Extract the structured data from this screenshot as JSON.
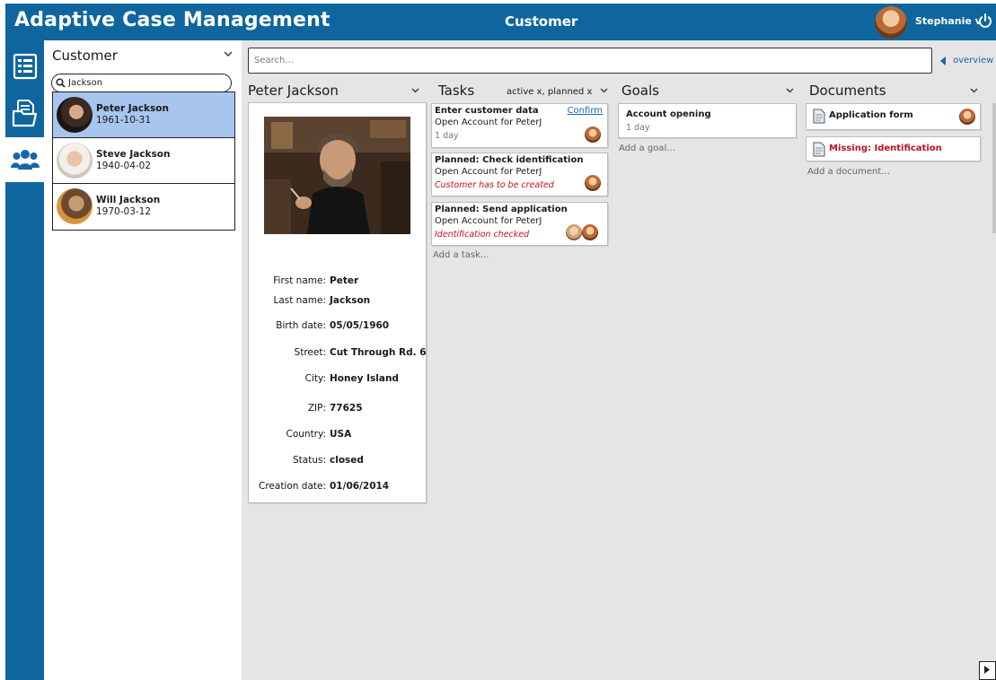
{
  "header": {
    "app_title": "Adaptive Case Management",
    "center_title": "Customer",
    "user_name": "Stephanie v",
    "brand_color": "#0f669f"
  },
  "rail": {
    "items": [
      {
        "icon": "list-icon",
        "active": false
      },
      {
        "icon": "document-folder-icon",
        "active": false
      },
      {
        "icon": "people-icon",
        "active": true
      }
    ]
  },
  "customer_panel": {
    "title": "Customer",
    "search_value": "Jackson",
    "customers": [
      {
        "name": "Peter Jackson",
        "date": "1961-10-31",
        "selected": true
      },
      {
        "name": "Steve Jackson",
        "date": "1940-04-02",
        "selected": false
      },
      {
        "name": "Will Jackson",
        "date": "1970-03-12",
        "selected": false
      }
    ]
  },
  "main": {
    "search_placeholder": "Search...",
    "overview_label": "overview"
  },
  "detail": {
    "header": "Peter Jackson",
    "fields": [
      {
        "label": "First name:",
        "value": "Peter"
      },
      {
        "label": "Last name:",
        "value": "Jackson"
      },
      {
        "label": "Birth date:",
        "value": "05/05/1960"
      },
      {
        "label": "Street:",
        "value": "Cut Through Rd. 6"
      },
      {
        "label": "City:",
        "value": "Honey Island"
      },
      {
        "label": "ZIP:",
        "value": "77625"
      },
      {
        "label": "Country:",
        "value": "USA"
      },
      {
        "label": "Status:",
        "value": "closed"
      },
      {
        "label": "Creation date:",
        "value": "01/06/2014"
      }
    ]
  },
  "tasks": {
    "header": "Tasks",
    "filter": "active x, planned x",
    "add_label": "Add a task...",
    "items": [
      {
        "title": "Enter customer data",
        "subtitle": "Open Account for PeterJ",
        "meta": "1 day",
        "action": "Confirm"
      },
      {
        "title": "Planned: Check identification",
        "subtitle": "Open Account for PeterJ",
        "warning": "Customer has to be created"
      },
      {
        "title": "Planned: Send application",
        "subtitle": "Open Account for PeterJ",
        "warning": "Identification checked"
      }
    ]
  },
  "goals": {
    "header": "Goals",
    "add_label": "Add a goal...",
    "items": [
      {
        "title": "Account opening",
        "meta": "1 day"
      }
    ]
  },
  "documents": {
    "header": "Documents",
    "add_label": "Add a document...",
    "items": [
      {
        "title": "Application form",
        "missing": false
      },
      {
        "title": "Missing: Identification",
        "missing": true
      }
    ]
  }
}
